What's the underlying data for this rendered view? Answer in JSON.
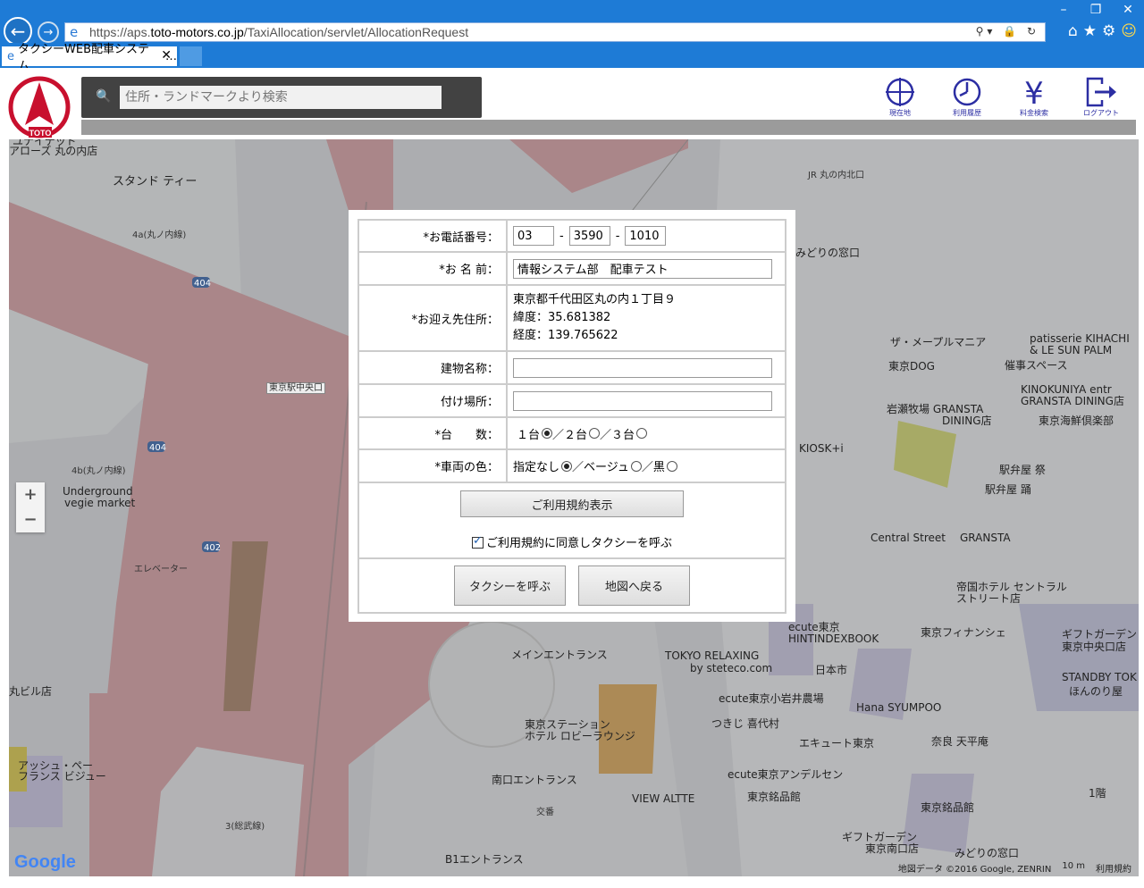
{
  "browser": {
    "url_prefix": "https://aps.",
    "url_domain": "toto-motors.co.jp",
    "url_path": "/TaxiAllocation/servlet/AllocationRequest",
    "tab_title": "タクシーWEB配車システム"
  },
  "header": {
    "search_placeholder": "住所・ランドマークより検索",
    "logo_text": "TOTO",
    "buttons": {
      "current_location": "現在地",
      "history": "利用履歴",
      "fare": "料金検索",
      "logout": "ログアウト"
    }
  },
  "form": {
    "phone_label": "*お電話番号：",
    "phone": {
      "part1": "03",
      "part2": "3590",
      "part3": "1010"
    },
    "phone_sep": "-",
    "name_label": "*お 名 前：",
    "name_value": "情報システム部　配車テスト",
    "pickup_label": "*お迎え先住所：",
    "pickup_address": "東京都千代田区丸の内１丁目９",
    "pickup_lat": "緯度：35.681382",
    "pickup_lng": "経度：139.765622",
    "building_label": "建物名称：",
    "building_value": "",
    "place_label": "付け場所：",
    "place_value": "",
    "count_label": "*台　　数：",
    "count_options": [
      "１台",
      "／２台",
      "／３台"
    ],
    "count_selected": 0,
    "color_label": "*車両の色：",
    "color_options": [
      "指定なし",
      "／ベージュ",
      "／黒"
    ],
    "color_selected": 0,
    "terms_button": "ご利用規約表示",
    "agree_label": "ご利用規約に同意しタクシーを呼ぶ",
    "agree_checked": true,
    "call_button": "タクシーを呼ぶ",
    "back_button": "地図へ戻る"
  },
  "map": {
    "labels": [
      "ユナイテッド",
      "アローズ 丸の内店",
      "スタンド ティー",
      "4a(丸ノ内線)",
      "東京駅中央口",
      "4b(丸ノ内線)",
      "Underground",
      "vegie market",
      "エレベーター",
      "丸ビル店",
      "アッシュ・ペー",
      "フランス ビジュー",
      "3(総武線)",
      "B1エントランス",
      "南口エントランス",
      "東京ステーション",
      "ホテル ロビーラウンジ",
      "メインエントランス",
      "VIEW ALTTE",
      "東京銘品館",
      "JR 丸の内北口",
      "みどりの窓口",
      "ザ・メープルマニア",
      "patisserie KIHACHI",
      "& LE SUN PALM",
      "東京DOG",
      "催事スペース",
      "KINOKUNIYA entr",
      "GRANSTA DINING店",
      "岩瀬牧場 GRANSTA",
      "DINING店",
      "東京海鮮倶楽部",
      "KIOSK+i",
      "駅弁屋 祭",
      "駅弁屋 踊",
      "Central Street",
      "GRANSTA",
      "帝国ホテル セントラル",
      "ストリート店",
      "ecute東京",
      "HINTINDEXBOOK",
      "東京フィナンシェ",
      "ギフトガーデン",
      "東京中央口店",
      "TOKYO RELAXING",
      "by steteco.com",
      "日本市",
      "ecute東京小岩井農場",
      "Hana SYUMPOO",
      "STANDBY TOK",
      "ほんのり屋",
      "つきじ 喜代村",
      "エキュート東京",
      "奈良 天平庵",
      "ecute東京アンデルセン",
      "東京銘品館",
      "ギフトガーデン",
      "東京南口店",
      "みどりの窓口",
      "1階",
      "交番"
    ],
    "road_numbers": [
      "404",
      "404",
      "402"
    ],
    "attribution": "地図データ ©2016 Google, ZENRIN",
    "scale": "10 m",
    "terms": "利用規約",
    "google": "Google",
    "zoom_in": "+",
    "zoom_out": "−"
  },
  "colors": {
    "brand_red": "#c8102e",
    "nav_blue": "#2c2ea3",
    "chrome_blue": "#1e7bd6"
  }
}
